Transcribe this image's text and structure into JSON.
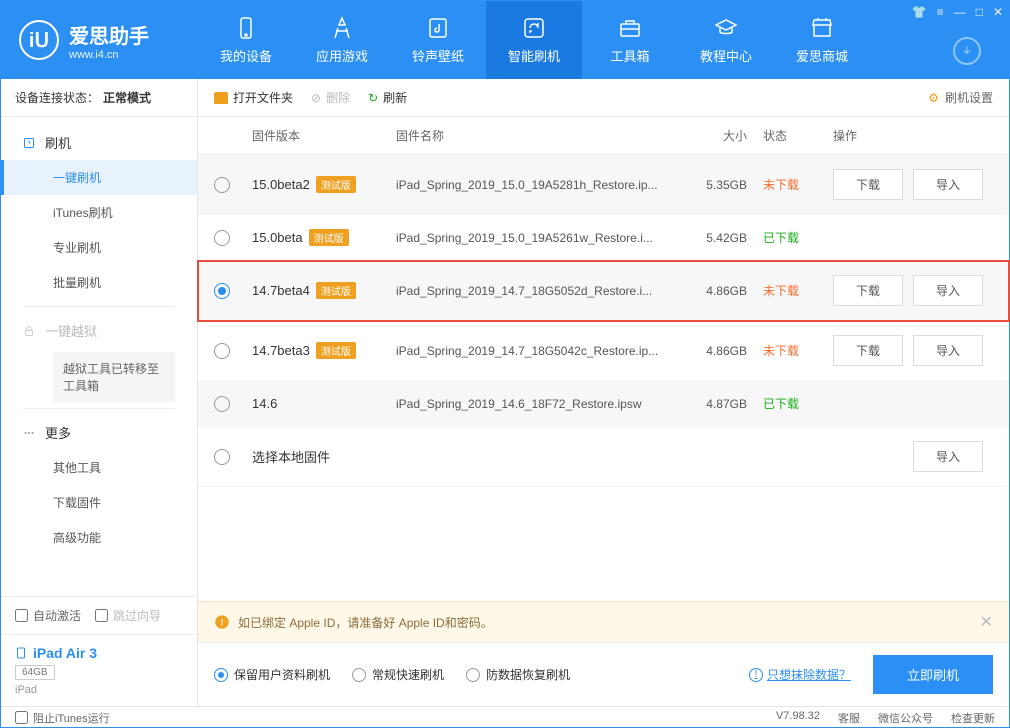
{
  "app": {
    "name": "爱思助手",
    "url": "www.i4.cn"
  },
  "nav": {
    "items": [
      {
        "label": "我的设备"
      },
      {
        "label": "应用游戏"
      },
      {
        "label": "铃声壁纸"
      },
      {
        "label": "智能刷机"
      },
      {
        "label": "工具箱"
      },
      {
        "label": "教程中心"
      },
      {
        "label": "爱思商城"
      }
    ]
  },
  "conn": {
    "label": "设备连接状态：",
    "value": "正常模式"
  },
  "side": {
    "flash": "刷机",
    "items1": [
      "一键刷机",
      "iTunes刷机",
      "专业刷机",
      "批量刷机"
    ],
    "jailbreak": "一键越狱",
    "jb_note": "越狱工具已转移至工具箱",
    "more": "更多",
    "items2": [
      "其他工具",
      "下载固件",
      "高级功能"
    ],
    "auto_activate": "自动激活",
    "skip_guide": "跳过向导",
    "device_name": "iPad Air 3",
    "device_storage": "64GB",
    "device_type": "iPad"
  },
  "toolbar": {
    "open": "打开文件夹",
    "delete": "删除",
    "refresh": "刷新",
    "settings": "刷机设置"
  },
  "table": {
    "headers": {
      "ver": "固件版本",
      "name": "固件名称",
      "size": "大小",
      "status": "状态",
      "ops": "操作"
    },
    "beta_tag": "测试版",
    "download": "下载",
    "import": "导入",
    "local": "选择本地固件",
    "rows": [
      {
        "ver": "15.0beta2",
        "beta": true,
        "name": "iPad_Spring_2019_15.0_19A5281h_Restore.ip...",
        "size": "5.35GB",
        "status": "未下载",
        "st": "not",
        "dl": true,
        "imp": true
      },
      {
        "ver": "15.0beta",
        "beta": true,
        "name": "iPad_Spring_2019_15.0_19A5261w_Restore.i...",
        "size": "5.42GB",
        "status": "已下载",
        "st": "done",
        "dl": false,
        "imp": false
      },
      {
        "ver": "14.7beta4",
        "beta": true,
        "name": "iPad_Spring_2019_14.7_18G5052d_Restore.i...",
        "size": "4.86GB",
        "status": "未下载",
        "st": "not",
        "dl": true,
        "imp": true,
        "selected": true
      },
      {
        "ver": "14.7beta3",
        "beta": true,
        "name": "iPad_Spring_2019_14.7_18G5042c_Restore.ip...",
        "size": "4.86GB",
        "status": "未下载",
        "st": "not",
        "dl": true,
        "imp": true
      },
      {
        "ver": "14.6",
        "beta": false,
        "name": "iPad_Spring_2019_14.6_18F72_Restore.ipsw",
        "size": "4.87GB",
        "status": "已下载",
        "st": "done",
        "dl": false,
        "imp": false
      }
    ]
  },
  "info": {
    "text": "如已绑定 Apple ID，请准备好 Apple ID和密码。"
  },
  "opts": {
    "keep": "保留用户资料刷机",
    "normal": "常规快速刷机",
    "anti": "防数据恢复刷机",
    "erase": "只想抹除数据？",
    "go": "立即刷机"
  },
  "footer": {
    "block_itunes": "阻止iTunes运行",
    "version": "V7.98.32",
    "service": "客服",
    "wechat": "微信公众号",
    "update": "检查更新"
  }
}
